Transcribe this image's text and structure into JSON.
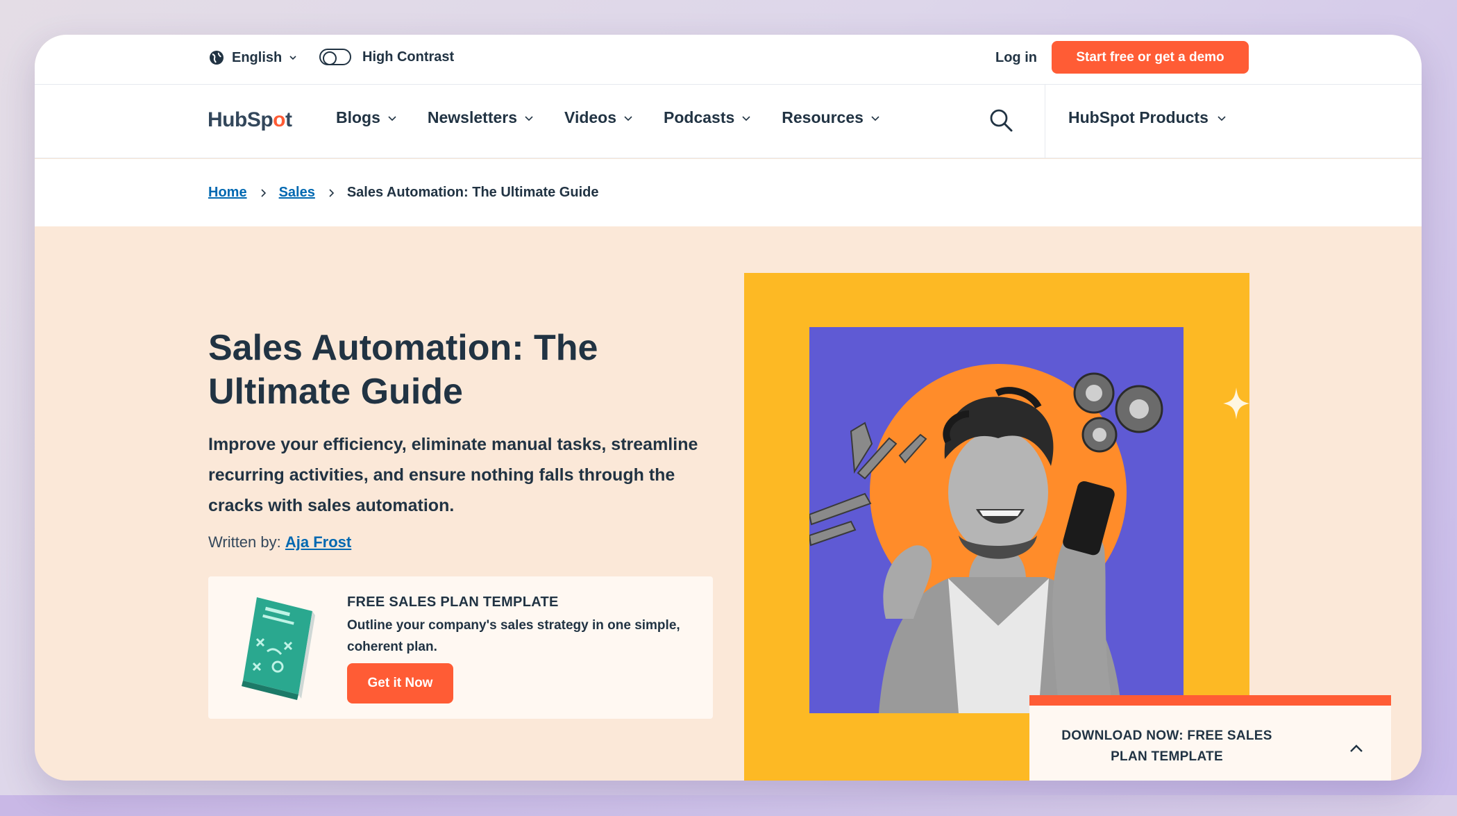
{
  "utility_bar": {
    "language": "English",
    "high_contrast_label": "High Contrast",
    "login_label": "Log in",
    "cta_label": "Start free or get a demo"
  },
  "nav": {
    "logo": {
      "part1": "HubSp",
      "part2": "o",
      "part3": "t"
    },
    "items": [
      {
        "label": "Blogs"
      },
      {
        "label": "Newsletters"
      },
      {
        "label": "Videos"
      },
      {
        "label": "Podcasts"
      },
      {
        "label": "Resources"
      }
    ],
    "products_label": "HubSpot Products"
  },
  "breadcrumb": {
    "home": "Home",
    "sales": "Sales",
    "current": "Sales Automation: The Ultimate Guide"
  },
  "hero": {
    "title": "Sales Automation: The Ultimate Guide",
    "subtitle": "Improve your efficiency, eliminate manual tasks, streamline recurring activities, and ensure nothing falls through the cracks with sales automation.",
    "written_by_label": "Written by:",
    "author": "Aja Frost"
  },
  "offer": {
    "title": "FREE SALES PLAN TEMPLATE",
    "description": "Outline your company's sales strategy in one simple, coherent plan.",
    "button_label": "Get it Now"
  },
  "download_banner": {
    "text": "DOWNLOAD NOW: FREE SALES PLAN TEMPLATE"
  },
  "colors": {
    "accent": "#ff5c35",
    "link": "#0068b1",
    "text": "#213343",
    "hero_bg": "#fbe8d8",
    "feature_yellow": "#fdb924",
    "feature_purple": "#5f5ad4",
    "feature_orange": "#ff8c2a"
  }
}
